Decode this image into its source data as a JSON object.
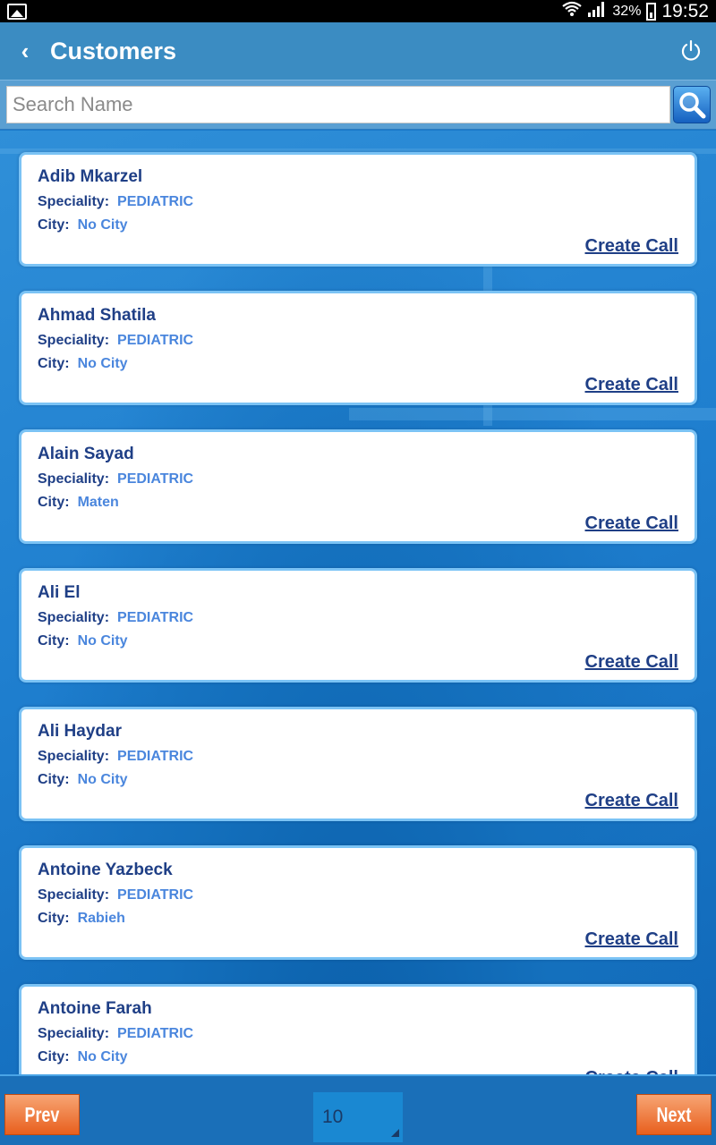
{
  "status_bar": {
    "battery_percent": "32%",
    "time": "19:52"
  },
  "app_bar": {
    "title": "Customers"
  },
  "search": {
    "placeholder": "Search Name",
    "value": ""
  },
  "labels": {
    "speciality": "Speciality:",
    "city": "City:",
    "create_call": "Create Call"
  },
  "customers": [
    {
      "name": "Adib Mkarzel",
      "speciality": "PEDIATRIC",
      "city": "No City"
    },
    {
      "name": "Ahmad Shatila",
      "speciality": "PEDIATRIC",
      "city": "No City"
    },
    {
      "name": "Alain Sayad",
      "speciality": "PEDIATRIC",
      "city": "Maten"
    },
    {
      "name": "Ali El",
      "speciality": "PEDIATRIC",
      "city": "No City"
    },
    {
      "name": "Ali Haydar",
      "speciality": "PEDIATRIC",
      "city": "No City"
    },
    {
      "name": "Antoine Yazbeck",
      "speciality": "PEDIATRIC",
      "city": "Rabieh"
    },
    {
      "name": "Antoine Farah",
      "speciality": "PEDIATRIC",
      "city": "No City"
    }
  ],
  "pagination": {
    "prev_label": "Prev",
    "next_label": "Next",
    "page_size": "10"
  },
  "colors": {
    "app_bar": "#3b8cc2",
    "card_border": "#7bc3f5",
    "name_text": "#1f3f86",
    "value_text": "#4a86dd",
    "nav_button": "#e85f1d"
  }
}
